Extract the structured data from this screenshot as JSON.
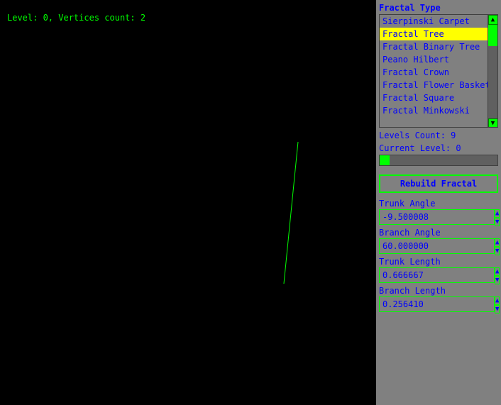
{
  "status": {
    "text": "Level: 0, Vertices count: 2"
  },
  "right_panel": {
    "fractal_type_label": "Fractal Type",
    "fractal_list": [
      {
        "id": "sierpinski",
        "label": "Sierpinski Carpet",
        "selected": false
      },
      {
        "id": "fractal-tree",
        "label": "Fractal Tree",
        "selected": true
      },
      {
        "id": "fractal-binary-tree",
        "label": "Fractal Binary Tree",
        "selected": false
      },
      {
        "id": "peano-hilbert",
        "label": "Peano Hilbert",
        "selected": false
      },
      {
        "id": "fractal-crown",
        "label": "Fractal Crown",
        "selected": false
      },
      {
        "id": "fractal-flower-basket",
        "label": "Fractal Flower Basket (",
        "selected": false
      },
      {
        "id": "fractal-square",
        "label": "Fractal Square",
        "selected": false
      },
      {
        "id": "fractal-minkowski",
        "label": "Fractal Minkowski",
        "selected": false
      }
    ],
    "levels_count_label": "Levels Count: 9",
    "current_level_label": "Current Level: 0",
    "rebuild_button_label": "Rebuild Fractal",
    "trunk_angle_label": "Trunk Angle",
    "trunk_angle_value": "-9.500008",
    "branch_angle_label": "Branch Angle",
    "branch_angle_value": "60.000000",
    "trunk_length_label": "Trunk Length",
    "trunk_length_value": "0.666667",
    "branch_length_label": "Branch Length",
    "branch_length_value": "0.256410"
  }
}
